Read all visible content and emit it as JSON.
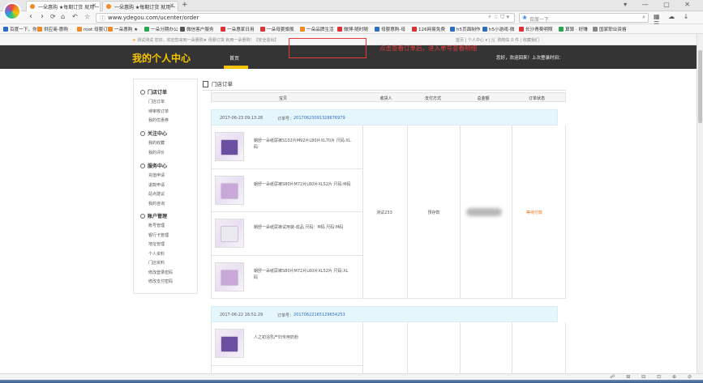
{
  "browser": {
    "tabs": [
      {
        "label": "一朵惠购 ★每期订货 就用一",
        "active": true
      },
      {
        "label": "一朵惠购 ★每期订货 就用一",
        "active": false
      }
    ],
    "new_tab": "+",
    "window_controls": "▾ — ▢ ✕",
    "url": "www.ydegou.com/ucenter/order",
    "search_placeholder": "百度一下",
    "bookmarks": [
      {
        "label": "百度一下，你",
        "color": "#2b6fc1"
      },
      {
        "label": "供应商-惠购",
        "color": "#f08a24"
      },
      {
        "label": "root 母婴订",
        "color": "#f08a24"
      },
      {
        "label": "一朵惠购 ★",
        "color": "#f08a24"
      },
      {
        "label": "一朵分期办公",
        "color": "#2ea44f"
      },
      {
        "label": "微信客户服务",
        "color": "#555"
      },
      {
        "label": "一朵惠家日用",
        "color": "#d33"
      },
      {
        "label": "一朵母婴旗舰",
        "color": "#d33"
      },
      {
        "label": "一朵品牌生活",
        "color": "#f08a24"
      },
      {
        "label": "微博-随时随",
        "color": "#d33"
      },
      {
        "label": "母婴惠购-母",
        "color": "#2b6fc1"
      },
      {
        "label": "126网易免费",
        "color": "#d33"
      },
      {
        "label": "h5页面制作",
        "color": "#2b6fc1"
      },
      {
        "label": "h5小游戏-微",
        "color": "#2b6fc1"
      },
      {
        "label": "长沙青葵明照",
        "color": "#d33"
      },
      {
        "label": "算算 · 好赚",
        "color": "#2ea44f"
      },
      {
        "label": "国家职业资格",
        "color": "#888"
      }
    ]
  },
  "site_top": {
    "welcome": "测试测试 您好，欢迎您来到一朵惠购★ 母婴订货 就用一朵惠购！【安全退出】",
    "links": "首页  |  个人中心 ▾  |  🛒 购物车 0 件  |  收藏我们"
  },
  "header": {
    "title": "我的个人中心",
    "home": "首页",
    "greeting": "您好，欢迎回来！上次登录时间："
  },
  "sidebar": {
    "groups": [
      {
        "title": "门店订单",
        "items": [
          "门店订单",
          "待审核订单",
          "我的优惠券"
        ]
      },
      {
        "title": "关注中心",
        "items": [
          "我的收藏",
          "我的评价"
        ]
      },
      {
        "title": "服务中心",
        "items": [
          "充值申请",
          "退款申请",
          "站点建议",
          "我的咨询"
        ]
      },
      {
        "title": "账户管理",
        "items": [
          "账号管理",
          "银行卡管理",
          "地址管理",
          "个人资料",
          "门店资料",
          "修改登录密码",
          "修改支付密码"
        ]
      }
    ]
  },
  "content": {
    "title": "门店订单",
    "columns": [
      "宝贝",
      "收货人",
      "支付方式",
      "总金额",
      "订单状态"
    ],
    "callout_text": "点击查看订单后，进入单号查看明细",
    "orders": [
      {
        "date": "2017-06-23 09:13:28",
        "order_no_label": "订单号：",
        "order_no": "20170623091328676979",
        "consignee": "测试233",
        "payment": "预存款",
        "amount": "",
        "status": "等待付款",
        "items": [
          "朝舒一朵纸尿裤S102片M92片L80片XL70片 尺码:XL码",
          "朝舒一朵纸尿裤S80片M72片L60片XL52片 尺码:M码",
          "朝舒一朵纸尿裤试用装-成品 尺码：M码 尺码:M码",
          "朝舒一朵纸尿裤S80片M72片L60片XL52片 尺码:XL码"
        ]
      },
      {
        "date": "2017-06-22 16:51:29",
        "order_no_label": "订单号：",
        "order_no": "20170622165129654253",
        "items": [
          "人之初浴乳产妇专用奶粉"
        ]
      }
    ]
  },
  "statusbar": {
    "icons": "☍ ⊞ ⊟ ⊡ ⊕ ⊘"
  },
  "colors": {
    "header_bg": "#343434",
    "title_yellow": "#f5c400",
    "order_head_bg": "#e6f6fd",
    "link_blue": "#2b6fc1",
    "callout_red": "#e53b3b",
    "status_orange": "#e8751a"
  }
}
